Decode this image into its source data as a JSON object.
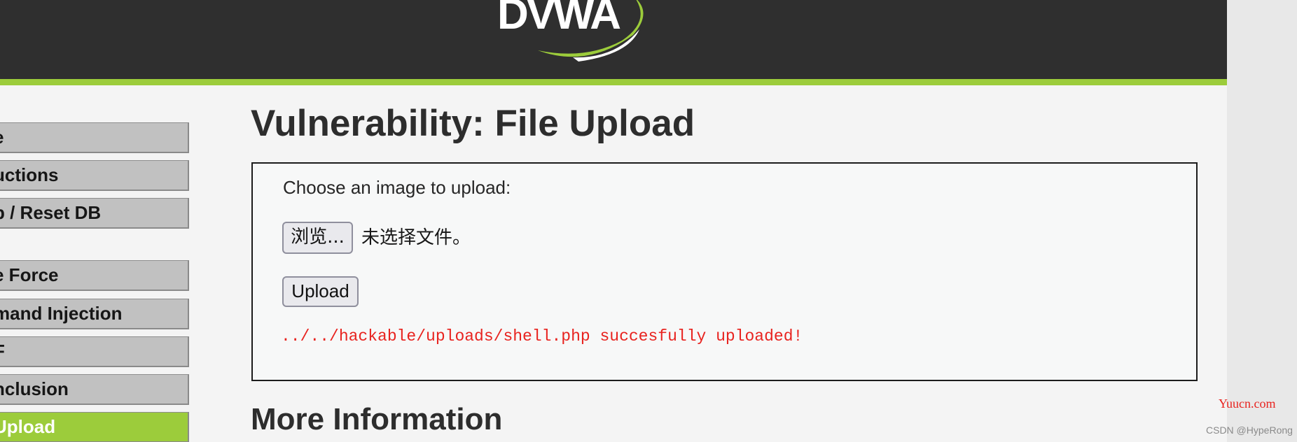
{
  "header": {
    "logo_text": "DVWA",
    "colors": {
      "background": "#2f2f2f",
      "accent": "#9ccc3b"
    }
  },
  "sidebar": {
    "items": [
      {
        "label": "Home",
        "visible": "e",
        "active": false
      },
      {
        "label": "Instructions",
        "visible": "uctions",
        "active": false
      },
      {
        "label": "Setup / Reset DB",
        "visible": "p / Reset DB",
        "active": false
      },
      {
        "label": "Brute Force",
        "visible": "e Force",
        "active": false
      },
      {
        "label": "Command Injection",
        "visible": "mand Injection",
        "active": false
      },
      {
        "label": "CSRF",
        "visible": "F",
        "active": false
      },
      {
        "label": "File Inclusion",
        "visible": "nclusion",
        "active": false
      },
      {
        "label": "File Upload",
        "visible": "Upload",
        "active": true
      }
    ]
  },
  "main": {
    "title": "Vulnerability: File Upload",
    "form": {
      "prompt": "Choose an image to upload:",
      "browse_label": "浏览...",
      "file_status": "未选择文件。",
      "upload_label": "Upload",
      "result_message": "../../hackable/uploads/shell.php succesfully uploaded!"
    },
    "more_info_heading": "More Information"
  },
  "watermarks": {
    "site": "Yuucn.com",
    "author": "CSDN @HypeRong"
  }
}
